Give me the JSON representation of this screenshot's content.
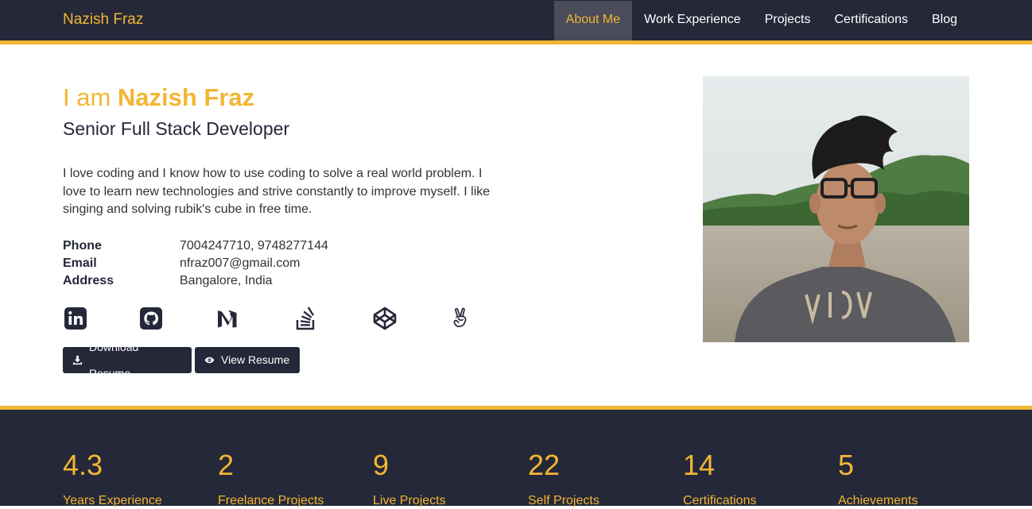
{
  "nav": {
    "brand": "Nazish Fraz",
    "items": [
      {
        "label": "About Me",
        "active": true
      },
      {
        "label": "Work Experience",
        "active": false
      },
      {
        "label": "Projects",
        "active": false
      },
      {
        "label": "Certifications",
        "active": false
      },
      {
        "label": "Blog",
        "active": false
      }
    ]
  },
  "hero": {
    "intro_prefix": "I am ",
    "name": "Nazish Fraz",
    "role": "Senior Full Stack Developer",
    "about": "I love coding and I know how to use coding to solve a real world problem. I love to learn new technologies and strive constantly to improve myself. I like singing and solving rubik's cube in free time.",
    "info": [
      {
        "label": "Phone",
        "value": "7004247710, 9748277144"
      },
      {
        "label": "Email",
        "value": "nfraz007@gmail.com"
      },
      {
        "label": "Address",
        "value": "Bangalore, India"
      }
    ],
    "socials": [
      {
        "name": "linkedin-icon"
      },
      {
        "name": "github-icon"
      },
      {
        "name": "medium-icon"
      },
      {
        "name": "stackoverflow-icon"
      },
      {
        "name": "codepen-icon"
      },
      {
        "name": "angellist-icon"
      }
    ],
    "buttons": {
      "download": "Download Resume",
      "view": "View Resume"
    }
  },
  "stats": [
    {
      "number": "4.3",
      "label": "Years Experience"
    },
    {
      "number": "2",
      "label": "Freelance Projects"
    },
    {
      "number": "9",
      "label": "Live Projects"
    },
    {
      "number": "22",
      "label": "Self Projects"
    },
    {
      "number": "14",
      "label": "Certifications"
    },
    {
      "number": "5",
      "label": "Achievements"
    }
  ],
  "colors": {
    "accent": "#f2b632",
    "dark": "#252839",
    "nav_active_bg": "#4a4c5a"
  }
}
